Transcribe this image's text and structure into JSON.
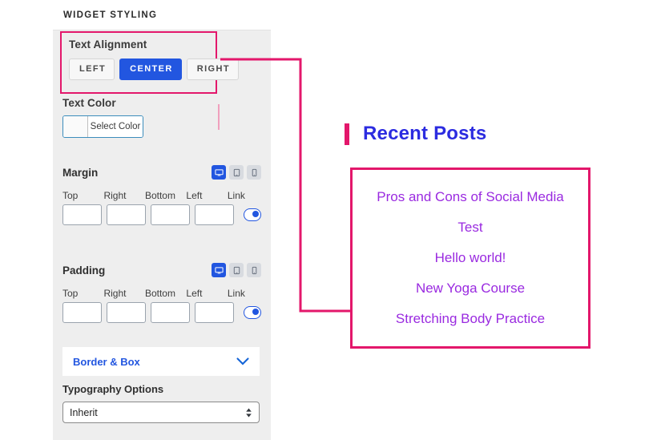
{
  "panel": {
    "header_title": "WIDGET STYLING",
    "text_alignment": {
      "label": "Text Alignment",
      "options": [
        "LEFT",
        "CENTER",
        "RIGHT"
      ],
      "selected": "CENTER",
      "highlight_color": "#e3176b",
      "active_color": "#2256e0"
    },
    "text_color": {
      "label": "Text Color",
      "button_label": "Select Color",
      "swatch_value": ""
    },
    "margin": {
      "title": "Margin",
      "devices": [
        "desktop-icon",
        "tablet-icon",
        "mobile-icon"
      ],
      "active_device": "desktop-icon",
      "field_labels": [
        "Top",
        "Right",
        "Bottom",
        "Left"
      ],
      "link_label": "Link",
      "values": [
        "",
        "",
        "",
        ""
      ],
      "link_enabled": true
    },
    "padding": {
      "title": "Padding",
      "devices": [
        "desktop-icon",
        "tablet-icon",
        "mobile-icon"
      ],
      "active_device": "desktop-icon",
      "field_labels": [
        "Top",
        "Right",
        "Bottom",
        "Left"
      ],
      "link_label": "Link",
      "values": [
        "",
        "",
        "",
        ""
      ],
      "link_enabled": true
    },
    "border_box": {
      "label": "Border & Box",
      "icon": "chevron-down-icon",
      "expanded": false
    },
    "typography": {
      "label": "Typography Options",
      "selected": "Inherit",
      "options": [
        "Inherit"
      ]
    }
  },
  "preview": {
    "heading": "Recent Posts",
    "heading_color": "#2c2ce0",
    "accent_color": "#e3176b",
    "link_color": "#9a2ae0",
    "posts": [
      "Pros and Cons of Social Media",
      "Test",
      "Hello world!",
      "New Yoga Course",
      "Stretching Body Practice"
    ]
  }
}
